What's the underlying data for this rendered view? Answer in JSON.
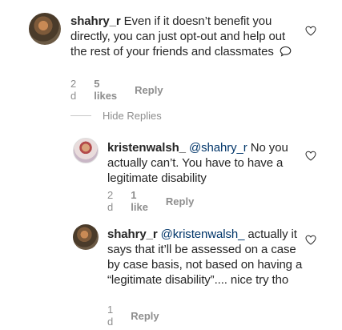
{
  "comments": [
    {
      "username": "shahry_r",
      "text": " Even if it doesn’t benefit you directly, you can just opt-out and help out the rest of your friends and classmates",
      "time": "2 d",
      "likes": "5 likes",
      "reply": "Reply"
    },
    {
      "username": "kristenwalsh_",
      "mention": "@shahry_r",
      "text": " No you actually can’t. You have to have a legitimate disability",
      "time": "2 d",
      "likes": "1 like",
      "reply": "Reply"
    },
    {
      "username": "shahry_r",
      "mention": "@kristenwalsh_",
      "text": " actually it says that it’ll be assessed on a case by case basis, not based on having a “legitimate disability”.... nice try tho",
      "time": "1 d",
      "reply": "Reply"
    }
  ],
  "hide_replies_label": "Hide Replies",
  "icons": {
    "like": "heart-outline-icon",
    "emoji": "speech-bubble-icon"
  }
}
